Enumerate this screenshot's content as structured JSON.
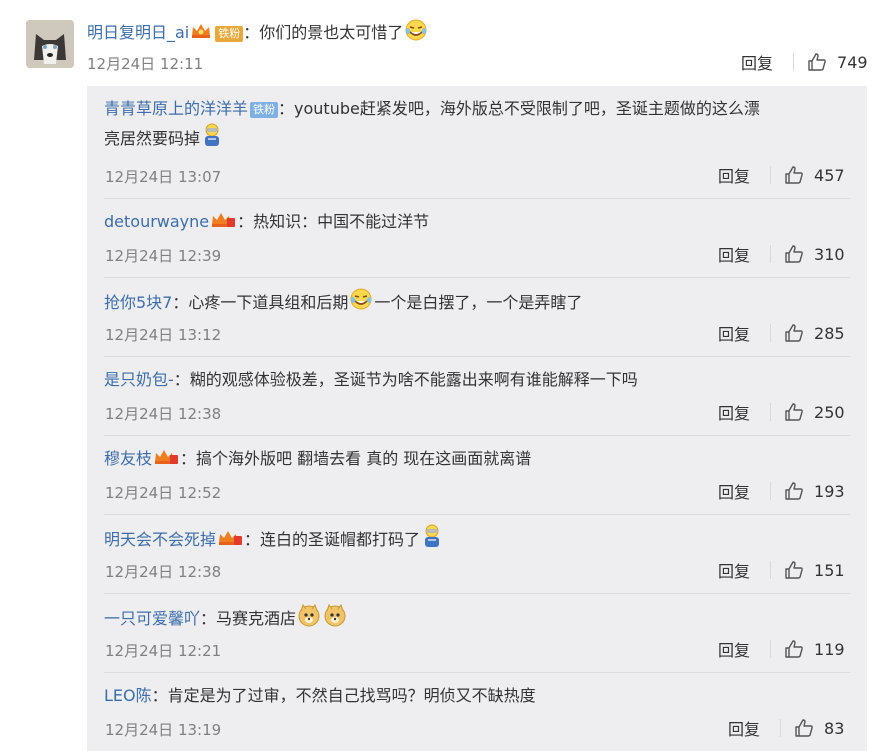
{
  "main_comment": {
    "username": "明日复明日_ai",
    "badge": "铁粉",
    "separator": "：",
    "text": "你们的景也太可惜了",
    "emoji": "cry-laugh-emoji",
    "time": "12月24日 12:11",
    "reply_label": "回复",
    "likes": "749"
  },
  "replies": [
    {
      "username": "青青草原上的洋洋羊",
      "badge": "铁粉",
      "text_line1": "：youtube赶紧发吧，海外版总不受限制了吧，圣诞主题做的这么漂",
      "text_line2": "亮居然要码掉",
      "time": "12月24日 13:07",
      "reply_label": "回复",
      "likes": "457"
    },
    {
      "username": "detourwayne",
      "text": "：热知识：中国不能过洋节",
      "time": "12月24日 12:39",
      "reply_label": "回复",
      "likes": "310"
    },
    {
      "username": "抢你5块7",
      "text_before": "：心疼一下道具组和后期",
      "text_after": "一个是白摆了，一个是弄瞎了",
      "time": "12月24日 13:12",
      "reply_label": "回复",
      "likes": "285"
    },
    {
      "username": "是只奶包-",
      "text": "：糊的观感体验极差，圣诞节为啥不能露出来啊有谁能解释一下吗",
      "time": "12月24日 12:38",
      "reply_label": "回复",
      "likes": "250"
    },
    {
      "username": "穆友枝",
      "text": "：搞个海外版吧 翻墙去看 真的 现在这画面就离谱",
      "time": "12月24日 12:52",
      "reply_label": "回复",
      "likes": "193"
    },
    {
      "username": "明天会不会死掉",
      "text": "：连白的圣诞帽都打码了",
      "time": "12月24日 12:38",
      "reply_label": "回复",
      "likes": "151"
    },
    {
      "username": "一只可爱馨吖",
      "text": "：马赛克酒店",
      "time": "12月24日 12:21",
      "reply_label": "回复",
      "likes": "119"
    },
    {
      "username": "LEO陈",
      "text": "：肯定是为了过审，不然自己找骂吗？明侦又不缺热度",
      "time": "12月24日 13:19",
      "reply_label": "回复",
      "likes": "83"
    }
  ],
  "colors": {
    "username": "#3d6dab",
    "meta": "#808080",
    "reply_bg": "#eeeef0",
    "badge_gold": "#e9a93a",
    "badge_blue": "#7fb0e3"
  }
}
